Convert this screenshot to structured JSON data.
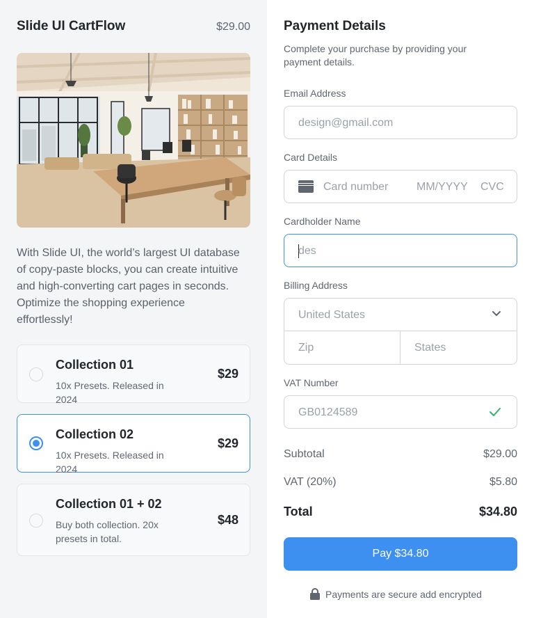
{
  "product": {
    "title": "Slide UI CartFlow",
    "price": "$29.00",
    "image_alt": "office-interior-photo",
    "description": "With Slide UI, the world’s largest UI database of copy-paste blocks, you can create intuitive and high-converting cart pages in seconds. Optimize the shopping experience effortlessly!"
  },
  "options": [
    {
      "title": "Collection 01",
      "subtitle": "10x Presets. Released in 2024",
      "price": "$29",
      "selected": false
    },
    {
      "title": "Collection 02",
      "subtitle": "10x Presets. Released in 2024",
      "price": "$29",
      "selected": true
    },
    {
      "title": "Collection 01 + 02",
      "subtitle": "Buy both collection. 20x presets in total.",
      "price": "$48",
      "selected": false
    }
  ],
  "payment": {
    "title": "Payment Details",
    "subtitle": "Complete your purchase by providing your payment details.",
    "email": {
      "label": "Email Address",
      "placeholder": "design@gmail.com"
    },
    "card": {
      "label": "Card Details",
      "number_placeholder": "Card number",
      "expiry_placeholder": "MM/YYYY",
      "cvc_placeholder": "CVC",
      "icon": "credit-card-icon"
    },
    "cardholder": {
      "label": "Cardholder Name",
      "value": "des"
    },
    "billing": {
      "label": "Billing Address",
      "country": "United States",
      "zip_placeholder": "Zip",
      "state_placeholder": "States",
      "icon": "chevron-down-icon"
    },
    "vat": {
      "label": "VAT Number",
      "value": "GB0124589",
      "icon": "check-icon"
    }
  },
  "summary": {
    "subtotal_label": "Subtotal",
    "subtotal_value": "$29.00",
    "vat_label": "VAT (20%)",
    "vat_value": "$5.80",
    "total_label": "Total",
    "total_value": "$34.80"
  },
  "pay_button": "Pay $34.80",
  "secure_note": "Payments are secure add encrypted",
  "colors": {
    "accent": "#3d8ff0",
    "valid": "#2fb36a",
    "left_bg": "#f4f5f7"
  }
}
